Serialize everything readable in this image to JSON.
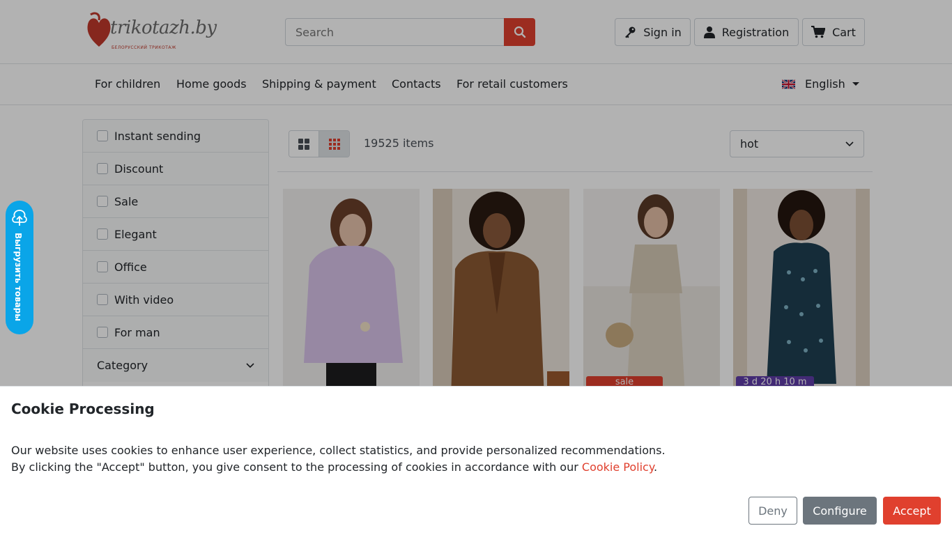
{
  "header": {
    "logo_text": "trikotazh.by",
    "logo_tagline": "БЕЛОРУССКИЙ ТРИКОТАЖ",
    "search_placeholder": "Search",
    "sign_in": "Sign in",
    "registration": "Registration",
    "cart": "Cart"
  },
  "nav": {
    "items": [
      "For children",
      "Home goods",
      "Shipping & payment",
      "Contacts",
      "For retail customers"
    ],
    "language": "English"
  },
  "sidebar": {
    "filters": [
      "Instant sending",
      "Discount",
      "Sale",
      "Elegant",
      "Office",
      "With video",
      "For man"
    ],
    "category_label": "Category"
  },
  "side_tab": {
    "label": "Выгрузить товары"
  },
  "toolbar": {
    "items_count": "19525 items",
    "sort_value": "hot"
  },
  "products": {
    "badges": {
      "sale": "sale",
      "timer": "3 d 20 h 10 m"
    }
  },
  "cookie": {
    "title": "Cookie Processing",
    "line1": "Our website uses cookies to enhance user experience, collect statistics, and provide personalized recommendations.",
    "line2_prefix": "By clicking the \"Accept\" button, you give consent to the processing of cookies in accordance with our ",
    "link_text": "Cookie Policy",
    "line2_suffix": ".",
    "deny": "Deny",
    "configure": "Configure",
    "accept": "Accept"
  },
  "colors": {
    "accent": "#e0402e",
    "side_tab": "#0aa5e8",
    "timer_badge": "#5f3da8",
    "secondary": "#6c757d"
  }
}
